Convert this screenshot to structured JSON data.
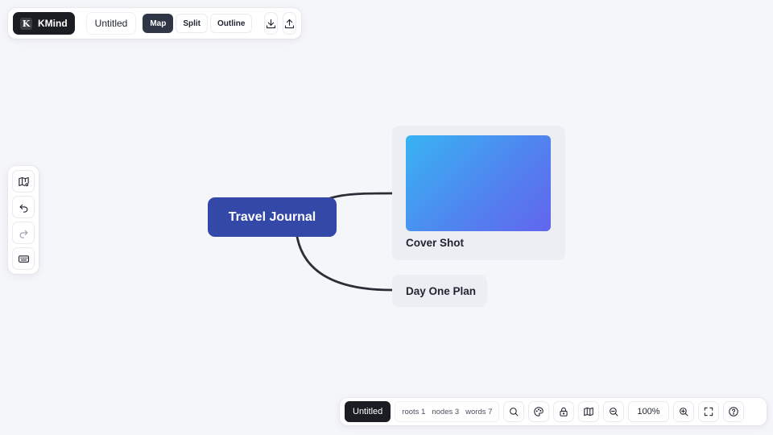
{
  "app": {
    "brand_letter": "K",
    "brand_name": "KMind",
    "doc_title": "Untitled"
  },
  "toolbar": {
    "view_modes": [
      {
        "label": "Map",
        "active": true
      },
      {
        "label": "Split",
        "active": false
      },
      {
        "label": "Outline",
        "active": false
      }
    ],
    "export_icon": "download-icon",
    "import_icon": "upload-icon"
  },
  "left_tools": [
    {
      "icon": "map-settings-icon"
    },
    {
      "icon": "undo-icon"
    },
    {
      "icon": "redo-icon"
    },
    {
      "icon": "keyboard-icon"
    }
  ],
  "mindmap": {
    "root": {
      "label": "Travel Journal"
    },
    "children": [
      {
        "label": "Cover Shot",
        "type": "image"
      },
      {
        "label": "Day One Plan",
        "type": "text"
      }
    ]
  },
  "status": {
    "title": "Untitled",
    "roots_label": "roots 1",
    "nodes_label": "nodes 3",
    "words_label": "words 7",
    "zoom": "100%"
  },
  "colors": {
    "root_node": "#3448a8",
    "edge": "#2b2e36",
    "brand_bg": "#1b1d22",
    "canvas_bg": "#f5f6fa"
  }
}
